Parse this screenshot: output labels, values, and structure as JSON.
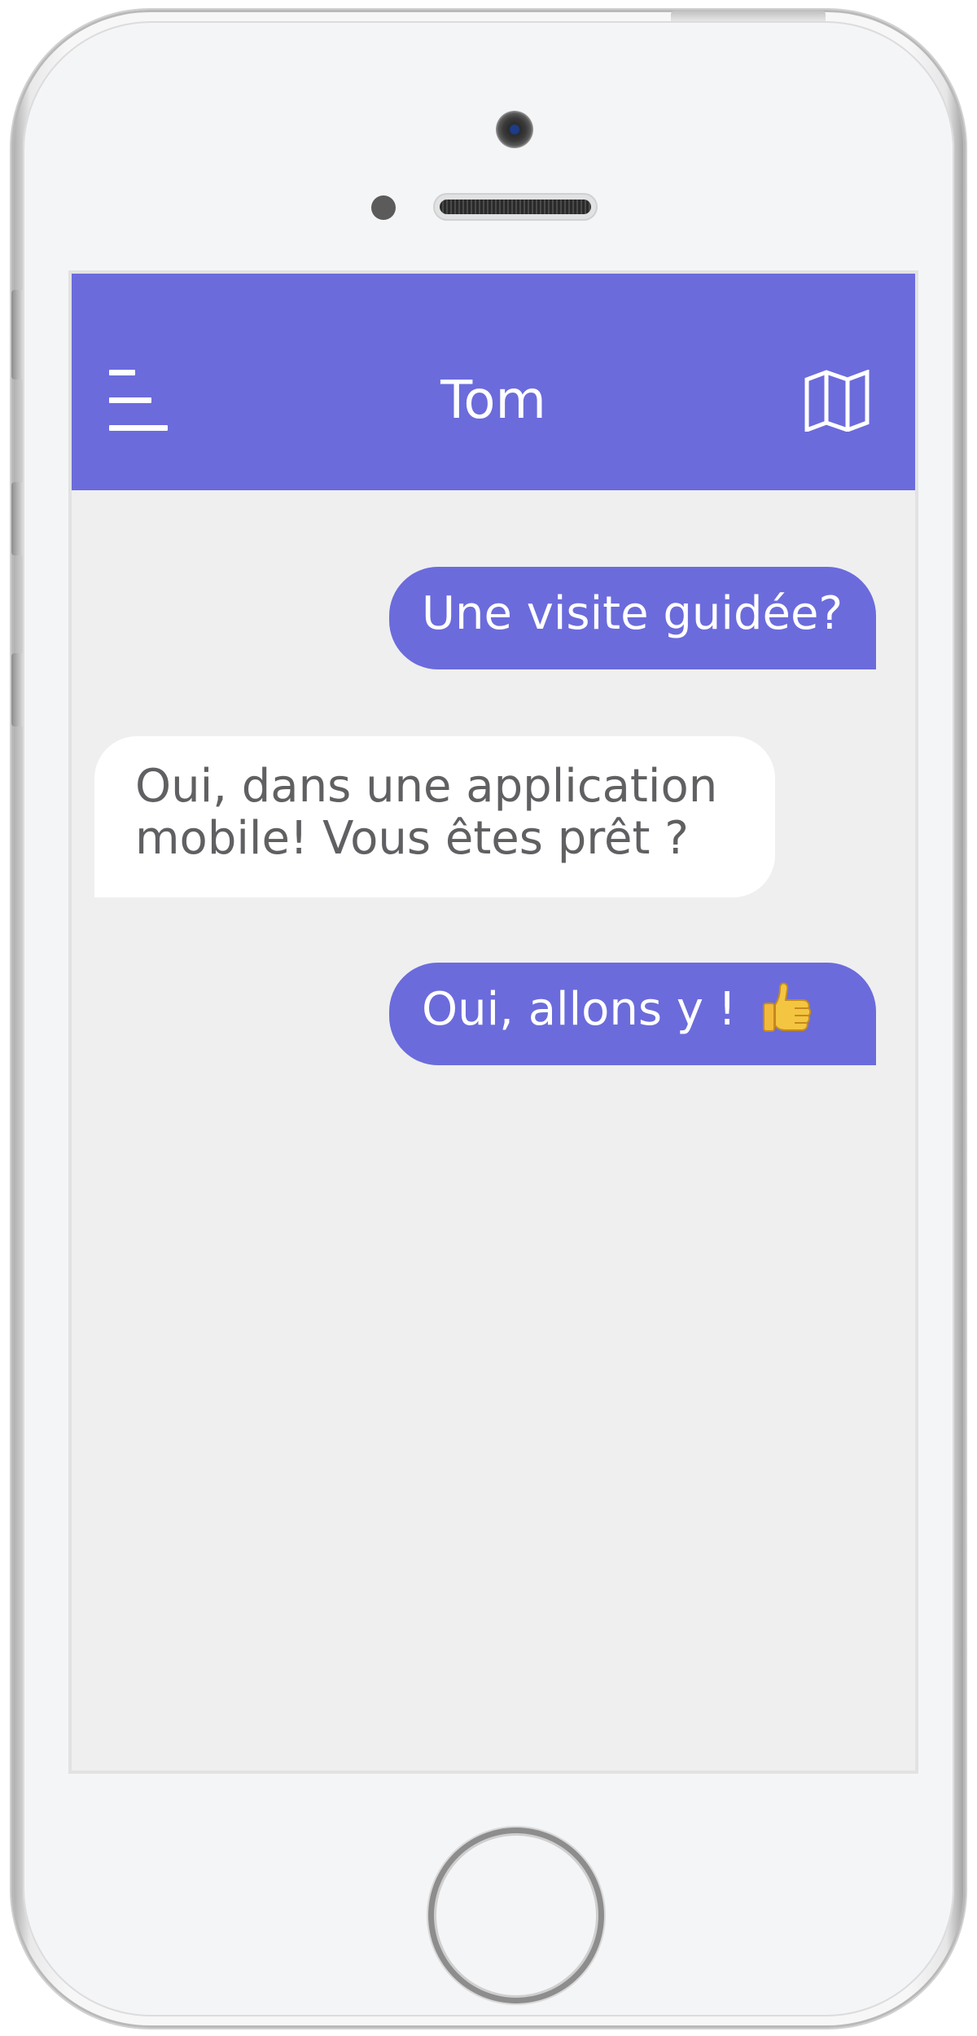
{
  "header": {
    "title": "Tom",
    "accent_color": "#6b6bdc",
    "menu_icon": "hamburger-menu-icon",
    "map_icon": "map-icon"
  },
  "messages": [
    {
      "direction": "outgoing",
      "text": "Une visite guidée?"
    },
    {
      "direction": "incoming",
      "text": "Oui, dans une application mobile! Vous êtes prêt ?"
    },
    {
      "direction": "outgoing",
      "text": "Oui, allons y !",
      "emoji": "thumbs-up-emoji"
    }
  ],
  "colors": {
    "outgoing_bubble": "#6b6bdc",
    "incoming_bubble": "#ffffff",
    "incoming_text": "#606063",
    "chat_background": "#efeff0"
  }
}
